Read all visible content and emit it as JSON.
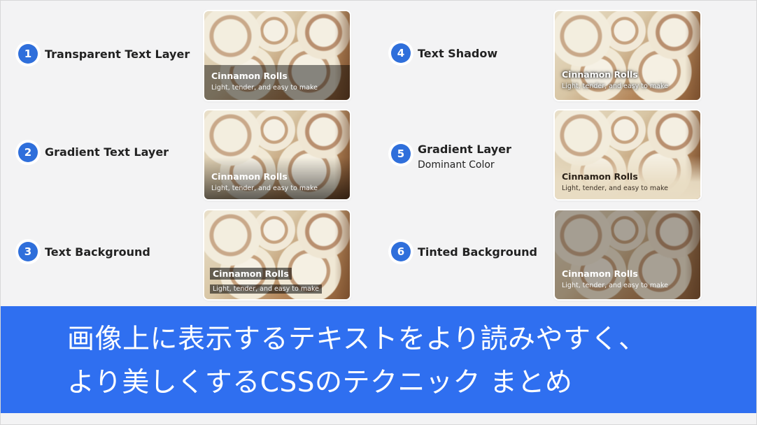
{
  "card": {
    "title": "Cinnamon Rolls",
    "subtitle": "Light, tender, and easy to make"
  },
  "items": [
    {
      "number": "1",
      "label": "Transparent Text Layer"
    },
    {
      "number": "2",
      "label": "Gradient Text Layer"
    },
    {
      "number": "3",
      "label": "Text Background"
    },
    {
      "number": "4",
      "label": "Text Shadow"
    },
    {
      "number": "5",
      "label": "Gradient Layer",
      "sublabel": "Dominant Color"
    },
    {
      "number": "6",
      "label": "Tinted Background"
    }
  ],
  "banner": {
    "line1": "画像上に表示するテキストをより読みやすく、",
    "line2": "より美しくするCSSのテクニック まとめ"
  },
  "colors": {
    "accent": "#2f6fdb",
    "banner": "#2f6ff0",
    "background": "#f3f3f4"
  }
}
